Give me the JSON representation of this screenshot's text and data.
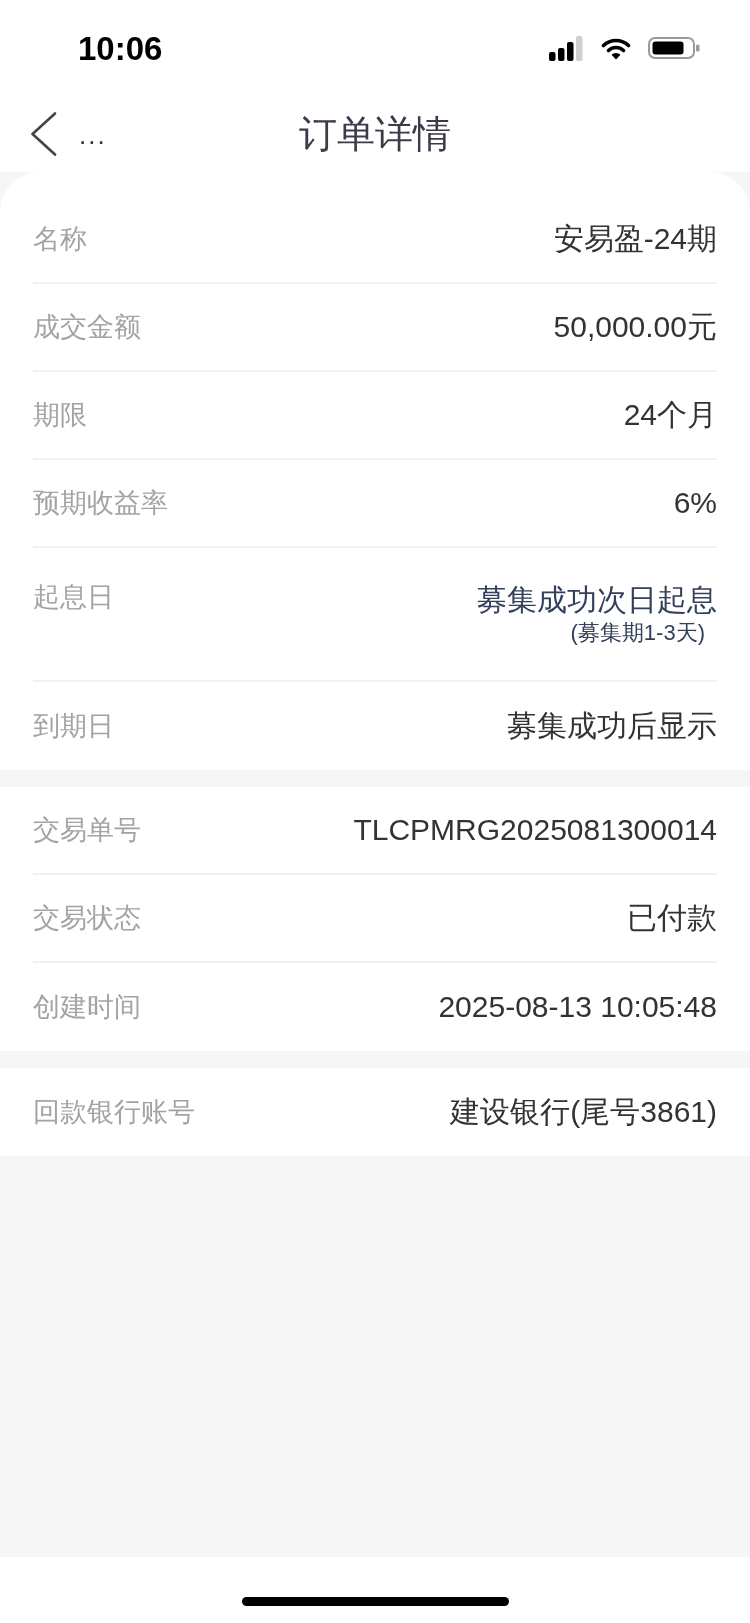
{
  "status_bar": {
    "time": "10:06"
  },
  "nav": {
    "back_label": "...",
    "title": "订单详情"
  },
  "sections": [
    {
      "rows": [
        {
          "label": "名称",
          "value": "安易盈-24期"
        },
        {
          "label": "成交金额",
          "value": "50,000.00元"
        },
        {
          "label": "期限",
          "value": "24个月"
        },
        {
          "label": "预期收益率",
          "value": "6%"
        },
        {
          "label": "起息日",
          "value": "募集成功次日起息",
          "note": "(募集期1-3天)"
        },
        {
          "label": "到期日",
          "value": "募集成功后显示"
        }
      ]
    },
    {
      "rows": [
        {
          "label": "交易单号",
          "value": "TLCPMRG2025081300014"
        },
        {
          "label": "交易状态",
          "value": "已付款"
        },
        {
          "label": "创建时间",
          "value": "2025-08-13 10:05:48"
        }
      ]
    },
    {
      "rows": [
        {
          "label": "回款银行账号",
          "value": "建设银行(尾号3861)"
        }
      ]
    }
  ]
}
